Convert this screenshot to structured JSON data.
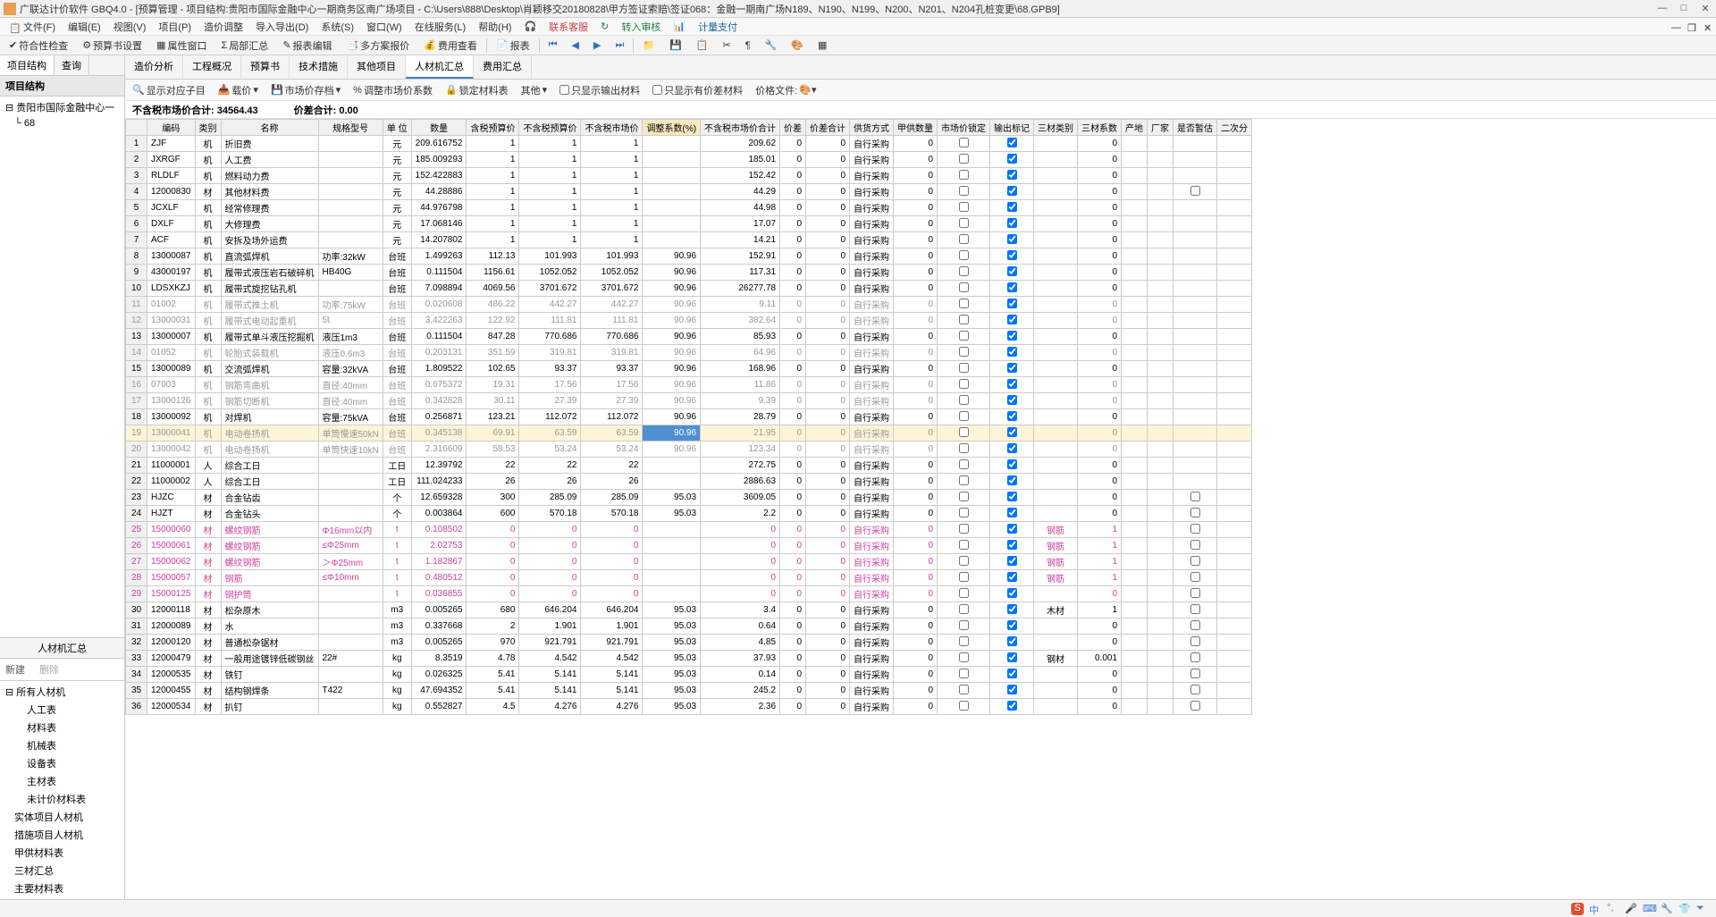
{
  "title": "广联达计价软件 GBQ4.0 - [预算管理 - 项目结构:贵阳市国际金融中心一期商务区南广场项目 - C:\\Users\\888\\Desktop\\肖颖移交20180828\\甲方签证索赔\\签证068：金融一期南广场N189、N190、N199、N200、N201、N204孔桩变更\\68.GPB9]",
  "menu": [
    "文件(F)",
    "编辑(E)",
    "视图(V)",
    "项目(P)",
    "造价调整",
    "导入导出(D)",
    "系统(S)",
    "窗口(W)",
    "在线服务(L)",
    "帮助(H)",
    "联系客服",
    "转入审核",
    "计量支付"
  ],
  "toolbar": [
    "符合性检查",
    "预算书设置",
    "属性窗口",
    "局部汇总",
    "报表编辑",
    "多方案报价",
    "费用查看",
    "报表"
  ],
  "left_tabs": [
    "项目结构",
    "查询"
  ],
  "left_header": "项目结构",
  "tree": {
    "root": "贵阳市国际金融中心一",
    "child": "68"
  },
  "bottom_header": "人材机汇总",
  "bottom_actions": [
    "新建",
    "删除"
  ],
  "bottom_tree": [
    "所有人材机",
    "人工表",
    "材料表",
    "机械表",
    "设备表",
    "主材表",
    "未计价材料表",
    "实体项目人材机",
    "措施项目人材机",
    "甲供材料表",
    "三材汇总",
    "主要材料表"
  ],
  "content_tabs": [
    "造价分析",
    "工程概况",
    "预算书",
    "技术措施",
    "其他项目",
    "人材机汇总",
    "费用汇总"
  ],
  "active_tab": 5,
  "filters": {
    "show_correspond": "显示对应子目",
    "load": "载价",
    "market_save": "市场价存档",
    "adjust": "调整市场价系数",
    "lock": "锁定材料表",
    "other": "其他",
    "only_output": "只显示输出材料",
    "only_diff": "只显示有价差材料",
    "price_file": "价格文件:"
  },
  "totals": {
    "market": "不含税市场价合计: 34564.43",
    "diff": "价差合计: 0.00"
  },
  "columns": [
    "",
    "编码",
    "类别",
    "名称",
    "规格型号",
    "单 位",
    "数量",
    "含税预算价",
    "不含税预算价",
    "不含税市场价",
    "调整系数(%)",
    "不含税市场价合计",
    "价差",
    "价差合计",
    "供货方式",
    "甲供数量",
    "市场价锁定",
    "输出标记",
    "三材类别",
    "三材系数",
    "产地",
    "厂家",
    "是否暂估",
    "二次分"
  ],
  "rows": [
    {
      "n": 1,
      "code": "ZJF",
      "cat": "机",
      "name": "折旧费",
      "unit": "元",
      "qty": "209.616752",
      "p1": "1",
      "p2": "1",
      "p3": "1",
      "adj": "",
      "sum": "209.62",
      "d1": "0",
      "d2": "0",
      "sup": "自行采购",
      "gq": "0",
      "lock": false,
      "out": true,
      "sc": "",
      "scx": "0"
    },
    {
      "n": 2,
      "code": "JXRGF",
      "cat": "机",
      "name": "人工费",
      "unit": "元",
      "qty": "185.009293",
      "p1": "1",
      "p2": "1",
      "p3": "1",
      "adj": "",
      "sum": "185.01",
      "d1": "0",
      "d2": "0",
      "sup": "自行采购",
      "gq": "0",
      "lock": false,
      "out": true,
      "sc": "",
      "scx": "0"
    },
    {
      "n": 3,
      "code": "RLDLF",
      "cat": "机",
      "name": "燃料动力费",
      "unit": "元",
      "qty": "152.422883",
      "p1": "1",
      "p2": "1",
      "p3": "1",
      "adj": "",
      "sum": "152.42",
      "d1": "0",
      "d2": "0",
      "sup": "自行采购",
      "gq": "0",
      "lock": false,
      "out": true,
      "sc": "",
      "scx": "0"
    },
    {
      "n": 4,
      "code": "12000830",
      "cat": "材",
      "name": "其他材料费",
      "unit": "元",
      "qty": "44.28886",
      "p1": "1",
      "p2": "1",
      "p3": "1",
      "adj": "",
      "sum": "44.29",
      "d1": "0",
      "d2": "0",
      "sup": "自行采购",
      "gq": "0",
      "lock": false,
      "out": true,
      "sc": "",
      "scx": "0",
      "est": false
    },
    {
      "n": 5,
      "code": "JCXLF",
      "cat": "机",
      "name": "经常修理费",
      "unit": "元",
      "qty": "44.976798",
      "p1": "1",
      "p2": "1",
      "p3": "1",
      "adj": "",
      "sum": "44.98",
      "d1": "0",
      "d2": "0",
      "sup": "自行采购",
      "gq": "0",
      "lock": false,
      "out": true,
      "sc": "",
      "scx": "0"
    },
    {
      "n": 6,
      "code": "DXLF",
      "cat": "机",
      "name": "大修理费",
      "unit": "元",
      "qty": "17.068146",
      "p1": "1",
      "p2": "1",
      "p3": "1",
      "adj": "",
      "sum": "17.07",
      "d1": "0",
      "d2": "0",
      "sup": "自行采购",
      "gq": "0",
      "lock": false,
      "out": true,
      "sc": "",
      "scx": "0"
    },
    {
      "n": 7,
      "code": "ACF",
      "cat": "机",
      "name": "安拆及场外运费",
      "unit": "元",
      "qty": "14.207802",
      "p1": "1",
      "p2": "1",
      "p3": "1",
      "adj": "",
      "sum": "14.21",
      "d1": "0",
      "d2": "0",
      "sup": "自行采购",
      "gq": "0",
      "lock": false,
      "out": true,
      "sc": "",
      "scx": "0"
    },
    {
      "n": 8,
      "code": "13000087",
      "cat": "机",
      "name": "直流弧焊机",
      "spec": "功率:32kW",
      "unit": "台班",
      "qty": "1.499263",
      "p1": "112.13",
      "p2": "101.993",
      "p3": "101.993",
      "adj": "90.96",
      "sum": "152.91",
      "d1": "0",
      "d2": "0",
      "sup": "自行采购",
      "gq": "0",
      "lock": false,
      "out": true,
      "sc": "",
      "scx": "0"
    },
    {
      "n": 9,
      "code": "43000197",
      "cat": "机",
      "name": "履带式液压岩石破碎机",
      "spec": "HB40G",
      "unit": "台班",
      "qty": "0.111504",
      "p1": "1156.61",
      "p2": "1052.052",
      "p3": "1052.052",
      "adj": "90.96",
      "sum": "117.31",
      "d1": "0",
      "d2": "0",
      "sup": "自行采购",
      "gq": "0",
      "lock": false,
      "out": true,
      "sc": "",
      "scx": "0"
    },
    {
      "n": 10,
      "code": "LDSXKZJ",
      "cat": "机",
      "name": "履带式旋挖钻孔机",
      "unit": "台班",
      "qty": "7.098894",
      "p1": "4069.56",
      "p2": "3701.672",
      "p3": "3701.672",
      "adj": "90.96",
      "sum": "26277.78",
      "d1": "0",
      "d2": "0",
      "sup": "自行采购",
      "gq": "0",
      "lock": false,
      "out": true,
      "sc": "",
      "scx": "0"
    },
    {
      "n": 11,
      "code": "01002",
      "cat": "机",
      "name": "履带式推土机",
      "spec": "功率:75kW",
      "unit": "台班",
      "qty": "0.020608",
      "p1": "486.22",
      "p2": "442.27",
      "p3": "442.27",
      "adj": "90.96",
      "sum": "9.11",
      "d1": "0",
      "d2": "0",
      "sup": "自行采购",
      "gq": "0",
      "lock": false,
      "out": true,
      "sc": "",
      "scx": "0",
      "gray": true
    },
    {
      "n": 12,
      "code": "13000031",
      "cat": "机",
      "name": "履带式电动起重机",
      "spec": "5t",
      "unit": "台班",
      "qty": "3.422263",
      "p1": "122.92",
      "p2": "111.81",
      "p3": "111.81",
      "adj": "90.96",
      "sum": "382.64",
      "d1": "0",
      "d2": "0",
      "sup": "自行采购",
      "gq": "0",
      "lock": false,
      "out": true,
      "sc": "",
      "scx": "0",
      "gray": true
    },
    {
      "n": 13,
      "code": "13000007",
      "cat": "机",
      "name": "履带式单斗液压挖掘机",
      "spec": "液压1m3",
      "unit": "台班",
      "qty": "0.111504",
      "p1": "847.28",
      "p2": "770.686",
      "p3": "770.686",
      "adj": "90.96",
      "sum": "85.93",
      "d1": "0",
      "d2": "0",
      "sup": "自行采购",
      "gq": "0",
      "lock": false,
      "out": true,
      "sc": "",
      "scx": "0"
    },
    {
      "n": 14,
      "code": "01052",
      "cat": "机",
      "name": "轮胎式装载机",
      "spec": "液压0.6m3",
      "unit": "台班",
      "qty": "0.203131",
      "p1": "351.59",
      "p2": "319.81",
      "p3": "319.81",
      "adj": "90.96",
      "sum": "64.96",
      "d1": "0",
      "d2": "0",
      "sup": "自行采购",
      "gq": "0",
      "lock": false,
      "out": true,
      "sc": "",
      "scx": "0",
      "gray": true
    },
    {
      "n": 15,
      "code": "13000089",
      "cat": "机",
      "name": "交流弧焊机",
      "spec": "容量:32kVA",
      "unit": "台班",
      "qty": "1.809522",
      "p1": "102.65",
      "p2": "93.37",
      "p3": "93.37",
      "adj": "90.96",
      "sum": "168.96",
      "d1": "0",
      "d2": "0",
      "sup": "自行采购",
      "gq": "0",
      "lock": false,
      "out": true,
      "sc": "",
      "scx": "0"
    },
    {
      "n": 16,
      "code": "07003",
      "cat": "机",
      "name": "钢筋弯曲机",
      "spec": "直径:40mm",
      "unit": "台班",
      "qty": "0.675372",
      "p1": "19.31",
      "p2": "17.56",
      "p3": "17.56",
      "adj": "90.96",
      "sum": "11.86",
      "d1": "0",
      "d2": "0",
      "sup": "自行采购",
      "gq": "0",
      "lock": false,
      "out": true,
      "sc": "",
      "scx": "0",
      "gray": true
    },
    {
      "n": 17,
      "code": "13000126",
      "cat": "机",
      "name": "钢筋切断机",
      "spec": "直径:40mm",
      "unit": "台班",
      "qty": "0.342828",
      "p1": "30.11",
      "p2": "27.39",
      "p3": "27.39",
      "adj": "90.96",
      "sum": "9.39",
      "d1": "0",
      "d2": "0",
      "sup": "自行采购",
      "gq": "0",
      "lock": false,
      "out": true,
      "sc": "",
      "scx": "0",
      "gray": true
    },
    {
      "n": 18,
      "code": "13000092",
      "cat": "机",
      "name": "对焊机",
      "spec": "容量:75kVA",
      "unit": "台班",
      "qty": "0.256871",
      "p1": "123.21",
      "p2": "112.072",
      "p3": "112.072",
      "adj": "90.96",
      "sum": "28.79",
      "d1": "0",
      "d2": "0",
      "sup": "自行采购",
      "gq": "0",
      "lock": false,
      "out": true,
      "sc": "",
      "scx": "0"
    },
    {
      "n": 19,
      "code": "13000041",
      "cat": "机",
      "name": "电动卷扬机",
      "spec": "单筒慢速50kN",
      "unit": "台班",
      "qty": "0.345138",
      "p1": "69.91",
      "p2": "63.59",
      "p3": "63.59",
      "adj": "90.96",
      "sum": "21.95",
      "d1": "0",
      "d2": "0",
      "sup": "自行采购",
      "gq": "0",
      "lock": false,
      "out": true,
      "sc": "",
      "scx": "0",
      "gray": true,
      "sel": true
    },
    {
      "n": 20,
      "code": "13000042",
      "cat": "机",
      "name": "电动卷扬机",
      "spec": "单筒快速10kN",
      "unit": "台班",
      "qty": "2.316609",
      "p1": "58.53",
      "p2": "53.24",
      "p3": "53.24",
      "adj": "90.96",
      "sum": "123.34",
      "d1": "0",
      "d2": "0",
      "sup": "自行采购",
      "gq": "0",
      "lock": false,
      "out": true,
      "sc": "",
      "scx": "0",
      "gray": true
    },
    {
      "n": 21,
      "code": "11000001",
      "cat": "人",
      "name": "综合工日",
      "unit": "工日",
      "qty": "12.39792",
      "p1": "22",
      "p2": "22",
      "p3": "22",
      "adj": "",
      "sum": "272.75",
      "d1": "0",
      "d2": "0",
      "sup": "自行采购",
      "gq": "0",
      "lock": false,
      "out": true,
      "sc": "",
      "scx": "0"
    },
    {
      "n": 22,
      "code": "11000002",
      "cat": "人",
      "name": "综合工日",
      "unit": "工日",
      "qty": "111.024233",
      "p1": "26",
      "p2": "26",
      "p3": "26",
      "adj": "",
      "sum": "2886.63",
      "d1": "0",
      "d2": "0",
      "sup": "自行采购",
      "gq": "0",
      "lock": false,
      "out": true,
      "sc": "",
      "scx": "0"
    },
    {
      "n": 23,
      "code": "HJZC",
      "cat": "材",
      "name": "合金钻齿",
      "unit": "个",
      "qty": "12.659328",
      "p1": "300",
      "p2": "285.09",
      "p3": "285.09",
      "adj": "95.03",
      "sum": "3609.05",
      "d1": "0",
      "d2": "0",
      "sup": "自行采购",
      "gq": "0",
      "lock": false,
      "out": true,
      "sc": "",
      "scx": "0",
      "est": false
    },
    {
      "n": 24,
      "code": "HJZT",
      "cat": "材",
      "name": "合金钻头",
      "unit": "个",
      "qty": "0.003864",
      "p1": "600",
      "p2": "570.18",
      "p3": "570.18",
      "adj": "95.03",
      "sum": "2.2",
      "d1": "0",
      "d2": "0",
      "sup": "自行采购",
      "gq": "0",
      "lock": false,
      "out": true,
      "sc": "",
      "scx": "0",
      "est": false
    },
    {
      "n": 25,
      "code": "15000060",
      "cat": "材",
      "name": "螺纹钢筋",
      "spec": "Φ16mm以内",
      "unit": "t",
      "qty": "0.108502",
      "p1": "0",
      "p2": "0",
      "p3": "0",
      "adj": "",
      "sum": "0",
      "d1": "0",
      "d2": "0",
      "sup": "自行采购",
      "gq": "0",
      "lock": false,
      "out": true,
      "sc": "钢筋",
      "scx": "1",
      "pink": true,
      "est": false
    },
    {
      "n": 26,
      "code": "15000061",
      "cat": "材",
      "name": "螺纹钢筋",
      "spec": "≤Φ25mm",
      "unit": "t",
      "qty": "2.02753",
      "p1": "0",
      "p2": "0",
      "p3": "0",
      "adj": "",
      "sum": "0",
      "d1": "0",
      "d2": "0",
      "sup": "自行采购",
      "gq": "0",
      "lock": false,
      "out": true,
      "sc": "钢筋",
      "scx": "1",
      "pink": true,
      "est": false
    },
    {
      "n": 27,
      "code": "15000062",
      "cat": "材",
      "name": "螺纹钢筋",
      "spec": "＞Φ25mm",
      "unit": "t",
      "qty": "1.182867",
      "p1": "0",
      "p2": "0",
      "p3": "0",
      "adj": "",
      "sum": "0",
      "d1": "0",
      "d2": "0",
      "sup": "自行采购",
      "gq": "0",
      "lock": false,
      "out": true,
      "sc": "钢筋",
      "scx": "1",
      "pink": true,
      "est": false
    },
    {
      "n": 28,
      "code": "15000057",
      "cat": "材",
      "name": "钢筋",
      "spec": "≤Φ10mm",
      "unit": "t",
      "qty": "0.480512",
      "p1": "0",
      "p2": "0",
      "p3": "0",
      "adj": "",
      "sum": "0",
      "d1": "0",
      "d2": "0",
      "sup": "自行采购",
      "gq": "0",
      "lock": false,
      "out": true,
      "sc": "钢筋",
      "scx": "1",
      "pink": true,
      "est": false
    },
    {
      "n": 29,
      "code": "15000125",
      "cat": "材",
      "name": "钢护筒",
      "unit": "t",
      "qty": "0.036855",
      "p1": "0",
      "p2": "0",
      "p3": "0",
      "adj": "",
      "sum": "0",
      "d1": "0",
      "d2": "0",
      "sup": "自行采购",
      "gq": "0",
      "lock": false,
      "out": true,
      "sc": "",
      "scx": "0",
      "pink": true,
      "est": false
    },
    {
      "n": 30,
      "code": "12000118",
      "cat": "材",
      "name": "松杂原木",
      "unit": "m3",
      "qty": "0.005265",
      "p1": "680",
      "p2": "646.204",
      "p3": "646.204",
      "adj": "95.03",
      "sum": "3.4",
      "d1": "0",
      "d2": "0",
      "sup": "自行采购",
      "gq": "0",
      "lock": false,
      "out": true,
      "sc": "木材",
      "scx": "1",
      "est": false
    },
    {
      "n": 31,
      "code": "12000089",
      "cat": "材",
      "name": "水",
      "unit": "m3",
      "qty": "0.337668",
      "p1": "2",
      "p2": "1.901",
      "p3": "1.901",
      "adj": "95.03",
      "sum": "0.64",
      "d1": "0",
      "d2": "0",
      "sup": "自行采购",
      "gq": "0",
      "lock": false,
      "out": true,
      "sc": "",
      "scx": "0",
      "est": false
    },
    {
      "n": 32,
      "code": "12000120",
      "cat": "材",
      "name": "普通松杂锯材",
      "unit": "m3",
      "qty": "0.005265",
      "p1": "970",
      "p2": "921.791",
      "p3": "921.791",
      "adj": "95.03",
      "sum": "4.85",
      "d1": "0",
      "d2": "0",
      "sup": "自行采购",
      "gq": "0",
      "lock": false,
      "out": true,
      "sc": "",
      "scx": "0",
      "est": false
    },
    {
      "n": 33,
      "code": "12000479",
      "cat": "材",
      "name": "一般用途镀锌低碳钢丝",
      "spec": "22#",
      "unit": "kg",
      "qty": "8.3519",
      "p1": "4.78",
      "p2": "4.542",
      "p3": "4.542",
      "adj": "95.03",
      "sum": "37.93",
      "d1": "0",
      "d2": "0",
      "sup": "自行采购",
      "gq": "0",
      "lock": false,
      "out": true,
      "sc": "钢材",
      "scx": "0.001",
      "est": false
    },
    {
      "n": 34,
      "code": "12000535",
      "cat": "材",
      "name": "铁钉",
      "unit": "kg",
      "qty": "0.026325",
      "p1": "5.41",
      "p2": "5.141",
      "p3": "5.141",
      "adj": "95.03",
      "sum": "0.14",
      "d1": "0",
      "d2": "0",
      "sup": "自行采购",
      "gq": "0",
      "lock": false,
      "out": true,
      "sc": "",
      "scx": "0",
      "est": false
    },
    {
      "n": 35,
      "code": "12000455",
      "cat": "材",
      "name": "结构钢焊条",
      "spec": "T422",
      "unit": "kg",
      "qty": "47.694352",
      "p1": "5.41",
      "p2": "5.141",
      "p3": "5.141",
      "adj": "95.03",
      "sum": "245.2",
      "d1": "0",
      "d2": "0",
      "sup": "自行采购",
      "gq": "0",
      "lock": false,
      "out": true,
      "sc": "",
      "scx": "0",
      "est": false
    },
    {
      "n": 36,
      "code": "12000534",
      "cat": "材",
      "name": "扒钉",
      "unit": "kg",
      "qty": "0.552827",
      "p1": "4.5",
      "p2": "4.276",
      "p3": "4.276",
      "adj": "95.03",
      "sum": "2.36",
      "d1": "0",
      "d2": "0",
      "sup": "自行采购",
      "gq": "0",
      "lock": false,
      "out": true,
      "sc": "",
      "scx": "0",
      "est": false
    }
  ]
}
